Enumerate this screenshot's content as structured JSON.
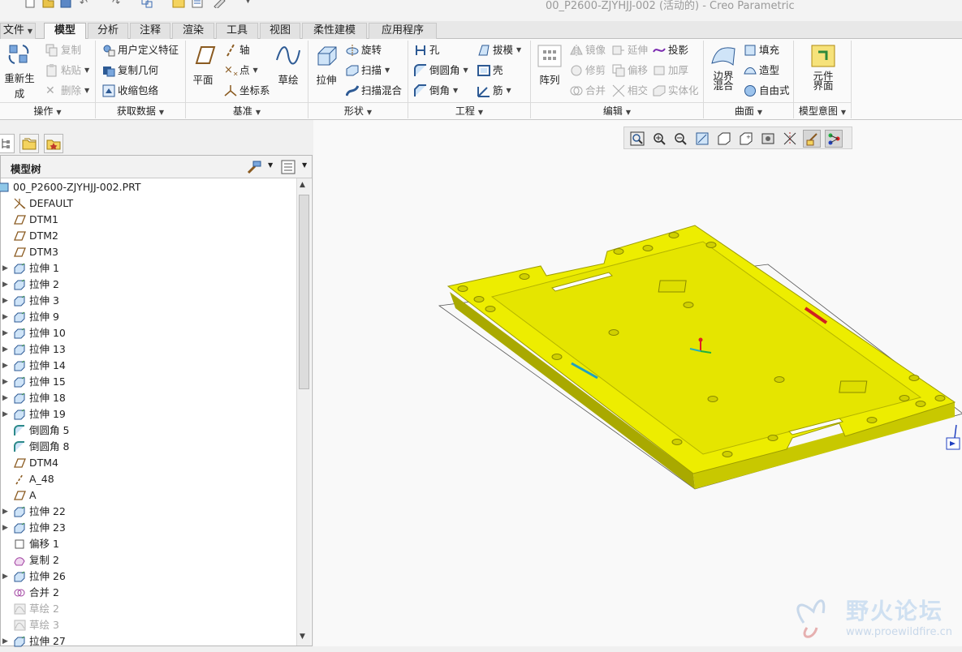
{
  "window": {
    "title": "00_P2600-ZJYHJJ-002 (活动的) - Creo Parametric"
  },
  "menu": {
    "file_label": "文件",
    "tabs": [
      "模型",
      "分析",
      "注释",
      "渲染",
      "工具",
      "视图",
      "柔性建模",
      "应用程序"
    ],
    "active_tab": "模型"
  },
  "ribbon": {
    "operations": {
      "regenerate": "重新生成",
      "copy": "复制",
      "paste": "粘贴",
      "delete": "删除",
      "group": "操作"
    },
    "get_data": {
      "udf": "用户定义特征",
      "copy_geom": "复制几何",
      "shrinkwrap": "收缩包络",
      "group": "获取数据"
    },
    "datum": {
      "plane": "平面",
      "axis": "轴",
      "point": "点",
      "csys": "坐标系",
      "sketch": "草绘",
      "group": "基准"
    },
    "shapes": {
      "extrude": "拉伸",
      "revolve": "旋转",
      "sweep": "扫描",
      "swept_blend": "扫描混合",
      "group": "形状"
    },
    "engineering": {
      "hole": "孔",
      "round": "倒圆角",
      "chamfer": "倒角",
      "draft": "拔模",
      "shell": "壳",
      "rib": "筋",
      "group": "工程"
    },
    "editing": {
      "pattern": "阵列",
      "mirror": "镜像",
      "trim": "修剪",
      "merge": "合并",
      "extend": "延伸",
      "offset": "偏移",
      "intersect": "相交",
      "project": "投影",
      "thicken": "加厚",
      "solidify": "实体化",
      "group": "编辑"
    },
    "surfaces": {
      "boundary_blend_1": "边界",
      "boundary_blend_2": "混合",
      "fill": "填充",
      "style": "造型",
      "freestyle": "自由式",
      "group": "曲面"
    },
    "model_intent": {
      "component_interface_1": "元件",
      "component_interface_2": "界面",
      "group": "模型意图"
    }
  },
  "model_tree": {
    "header": "模型树",
    "items": [
      {
        "label": "00_P2600-ZJYHJJ-002.PRT",
        "icon": "part-icon",
        "expand": false,
        "dim": false
      },
      {
        "label": "DEFAULT",
        "icon": "csys-icon",
        "expand": false,
        "dim": false
      },
      {
        "label": "DTM1",
        "icon": "datum-plane-icon",
        "expand": false,
        "dim": false
      },
      {
        "label": "DTM2",
        "icon": "datum-plane-icon",
        "expand": false,
        "dim": false
      },
      {
        "label": "DTM3",
        "icon": "datum-plane-icon",
        "expand": false,
        "dim": false
      },
      {
        "label": "拉伸 1",
        "icon": "extrude-icon",
        "expand": true,
        "dim": false
      },
      {
        "label": "拉伸 2",
        "icon": "extrude-icon",
        "expand": true,
        "dim": false
      },
      {
        "label": "拉伸 3",
        "icon": "extrude-icon",
        "expand": true,
        "dim": false
      },
      {
        "label": "拉伸 9",
        "icon": "extrude-icon",
        "expand": true,
        "dim": false
      },
      {
        "label": "拉伸 10",
        "icon": "extrude-icon",
        "expand": true,
        "dim": false
      },
      {
        "label": "拉伸 13",
        "icon": "extrude-icon",
        "expand": true,
        "dim": false
      },
      {
        "label": "拉伸 14",
        "icon": "extrude-icon",
        "expand": true,
        "dim": false
      },
      {
        "label": "拉伸 15",
        "icon": "extrude-icon",
        "expand": true,
        "dim": false
      },
      {
        "label": "拉伸 18",
        "icon": "extrude-icon",
        "expand": true,
        "dim": false
      },
      {
        "label": "拉伸 19",
        "icon": "extrude-icon",
        "expand": true,
        "dim": false
      },
      {
        "label": "倒圆角 5",
        "icon": "round-icon",
        "expand": false,
        "dim": false
      },
      {
        "label": "倒圆角 8",
        "icon": "round-icon",
        "expand": false,
        "dim": false
      },
      {
        "label": "DTM4",
        "icon": "datum-plane-icon",
        "expand": false,
        "dim": false
      },
      {
        "label": "A_48",
        "icon": "datum-axis-icon",
        "expand": false,
        "dim": false
      },
      {
        "label": "A",
        "icon": "datum-plane-icon",
        "expand": false,
        "dim": false
      },
      {
        "label": "拉伸 22",
        "icon": "extrude-icon",
        "expand": true,
        "dim": false
      },
      {
        "label": "拉伸 23",
        "icon": "extrude-icon",
        "expand": true,
        "dim": false
      },
      {
        "label": "偏移 1",
        "icon": "offset-icon",
        "expand": false,
        "dim": false
      },
      {
        "label": "复制 2",
        "icon": "copy-surface-icon",
        "expand": false,
        "dim": false
      },
      {
        "label": "拉伸 26",
        "icon": "extrude-icon",
        "expand": true,
        "dim": false
      },
      {
        "label": "合并 2",
        "icon": "merge-icon",
        "expand": false,
        "dim": false
      },
      {
        "label": "草绘 2",
        "icon": "sketch-icon",
        "expand": false,
        "dim": true
      },
      {
        "label": "草绘 3",
        "icon": "sketch-icon",
        "expand": false,
        "dim": true
      },
      {
        "label": "拉伸 27",
        "icon": "extrude-icon",
        "expand": true,
        "dim": false
      }
    ]
  },
  "viewport": {
    "part_color": "#e8e800",
    "watermark_cn": "野火论坛",
    "watermark_url": "www.proewildfire.cn"
  }
}
